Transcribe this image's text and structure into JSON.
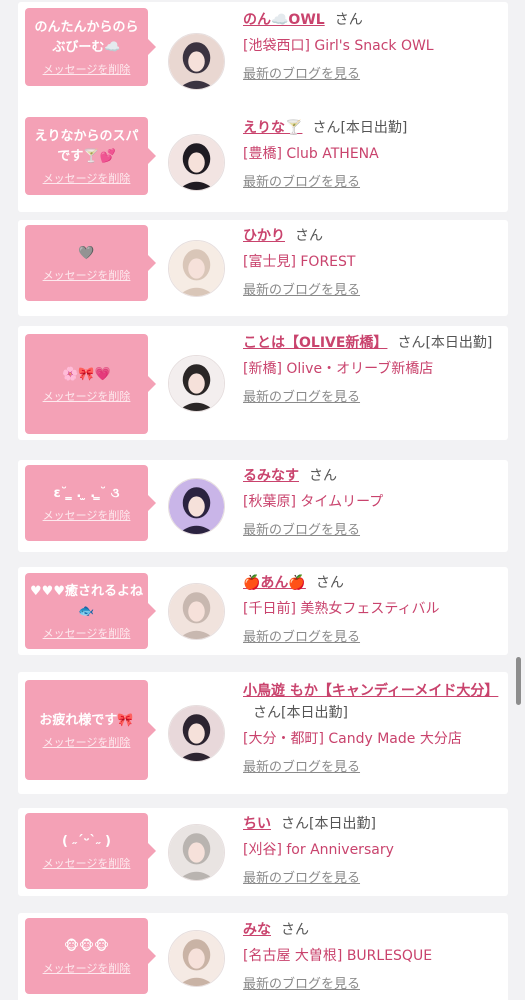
{
  "honorific": "さん",
  "delete_label": "メッセージを削除",
  "blog_label": "最新のブログを見る",
  "colors": {
    "bubble": "#f4a1b6",
    "link": "#c9436d",
    "background": "#f2f2f4"
  },
  "items": [
    {
      "message": "のんたんからのらぶびーむ☁️",
      "name": "のん☁️OWL",
      "status": "",
      "shop": "[池袋西口] Girl's Snack OWL"
    },
    {
      "message": "えりなからのスパです🍸💕",
      "name": "えりな🍸",
      "status": "[本日出勤]",
      "shop": "[豊橋] Club ATHENA"
    },
    {
      "message": "🩶",
      "name": "ひかり",
      "status": "",
      "shop": "[富士見] FOREST"
    },
    {
      "message": "🌸🎀💗",
      "name": "ことは【OLIVE新橋】",
      "status": "[本日出勤]",
      "shop": "[新橋] Olive・オリーブ新橋店"
    },
    {
      "message": "ε˘ ̳ . ̫ . ̳˘ ૩",
      "name": "るみなす",
      "status": "",
      "shop": "[秋葉原] タイムリープ"
    },
    {
      "message": "♥♥♥癒されるよね🐟",
      "name": "🍎あん🍎",
      "status": "",
      "shop": "[千日前] 美熟女フェスティバル"
    },
    {
      "message": "お疲れ様です🎀",
      "name": "小鳥遊 もか【キャンディーメイド大分】",
      "status": "[本日出勤]",
      "shop": "[大分・都町] Candy Made 大分店"
    },
    {
      "message": "( ˶ˊᵕˋ˶ )",
      "name": "ちい",
      "status": "[本日出勤]",
      "shop": "[刈谷] for Anniversary"
    },
    {
      "message": "🐵🐵🐵",
      "name": "みな",
      "status": "",
      "shop": "[名古屋 大曽根] BURLESQUE"
    }
  ]
}
